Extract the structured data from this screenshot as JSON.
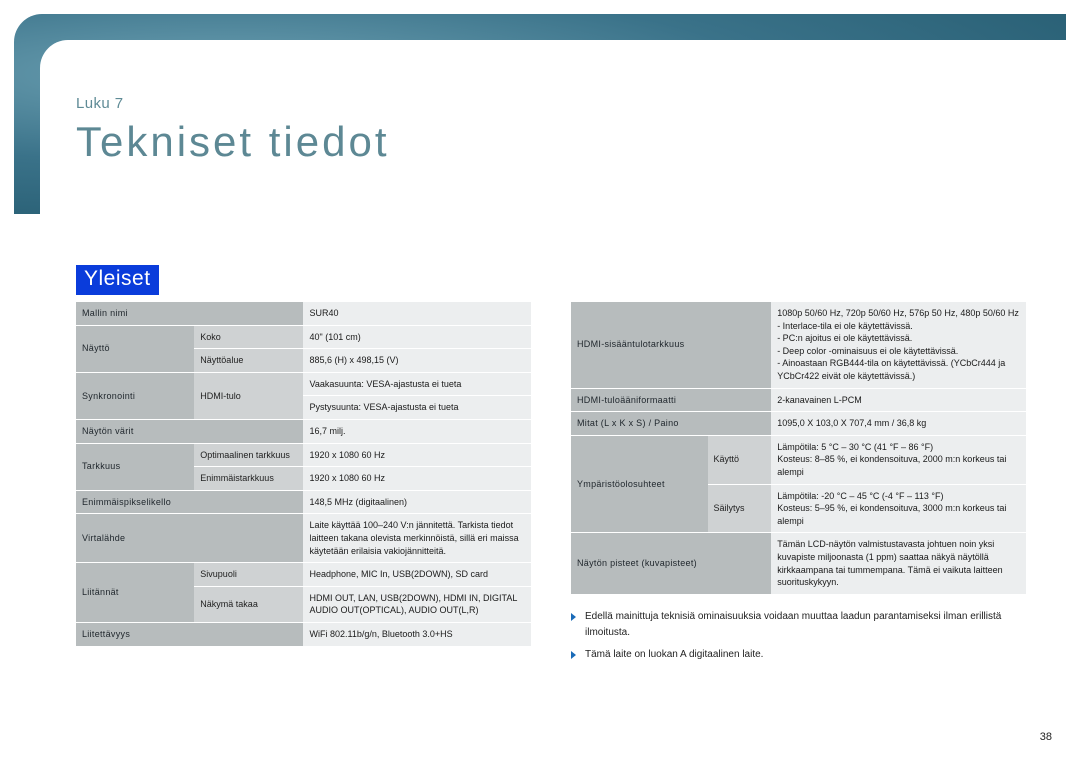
{
  "chapter": "Luku 7",
  "title": "Tekniset tiedot",
  "section": "Yleiset",
  "page_number": "38",
  "left_table": {
    "rows": [
      {
        "cells": [
          {
            "text": "Mallin nimi",
            "class": "hdr",
            "colspan": 2
          },
          {
            "text": "SUR40",
            "class": "val"
          }
        ]
      },
      {
        "cells": [
          {
            "text": "Näyttö",
            "class": "hdr",
            "rowspan": 2
          },
          {
            "text": "Koko",
            "class": "sub"
          },
          {
            "text": "40\" (101 cm)",
            "class": "val"
          }
        ]
      },
      {
        "cells": [
          {
            "text": "Näyttöalue",
            "class": "sub"
          },
          {
            "text": "885,6 (H) x 498,15 (V)",
            "class": "val"
          }
        ]
      },
      {
        "cells": [
          {
            "text": "Synkronointi",
            "class": "hdr",
            "rowspan": 2
          },
          {
            "text": "HDMI-tulo",
            "class": "sub",
            "rowspan": 2
          },
          {
            "text": "Vaakasuunta: VESA-ajastusta ei tueta",
            "class": "val"
          }
        ]
      },
      {
        "cells": [
          {
            "text": "Pystysuunta: VESA-ajastusta ei tueta",
            "class": "val"
          }
        ]
      },
      {
        "cells": [
          {
            "text": "Näytön värit",
            "class": "hdr",
            "colspan": 2
          },
          {
            "text": "16,7 milj.",
            "class": "val"
          }
        ]
      },
      {
        "cells": [
          {
            "text": "Tarkkuus",
            "class": "hdr",
            "rowspan": 2
          },
          {
            "text": "Optimaalinen tarkkuus",
            "class": "sub"
          },
          {
            "text": "1920 x 1080 60 Hz",
            "class": "val"
          }
        ]
      },
      {
        "cells": [
          {
            "text": "Enimmäistarkkuus",
            "class": "sub"
          },
          {
            "text": "1920 x 1080 60 Hz",
            "class": "val"
          }
        ]
      },
      {
        "cells": [
          {
            "text": "Enimmäispikselikello",
            "class": "hdr",
            "colspan": 2
          },
          {
            "text": "148,5 MHz (digitaalinen)",
            "class": "val"
          }
        ]
      },
      {
        "cells": [
          {
            "text": "Virtalähde",
            "class": "hdr",
            "colspan": 2
          },
          {
            "text": "Laite käyttää 100–240 V:n jännitettä. Tarkista tiedot laitteen takana olevista merkinnöistä, sillä eri maissa käytetään erilaisia vakiojännitteitä.",
            "class": "val"
          }
        ]
      },
      {
        "cells": [
          {
            "text": "Liitännät",
            "class": "hdr",
            "rowspan": 2
          },
          {
            "text": "Sivupuoli",
            "class": "sub"
          },
          {
            "text": "Headphone, MIC In, USB(2DOWN), SD card",
            "class": "val"
          }
        ]
      },
      {
        "cells": [
          {
            "text": "Näkymä takaa",
            "class": "sub"
          },
          {
            "text": "HDMI OUT, LAN, USB(2DOWN), HDMI IN, DIGITAL AUDIO OUT(OPTICAL), AUDIO OUT(L,R)",
            "class": "val"
          }
        ]
      },
      {
        "cells": [
          {
            "text": "Liitettävyys",
            "class": "hdr",
            "colspan": 2
          },
          {
            "text": "WiFi 802.11b/g/n, Bluetooth 3.0+HS",
            "class": "val"
          }
        ]
      }
    ]
  },
  "right_table": {
    "rows": [
      {
        "cells": [
          {
            "text": "HDMI-sisääntulotarkkuus",
            "class": "hdr",
            "colspan": 2
          },
          {
            "text": "1080p 50/60 Hz, 720p 50/60 Hz, 576p 50 Hz, 480p 50/60 Hz\n- Interlace-tila ei ole käytettävissä.\n- PC:n ajoitus ei ole käytettävissä.\n- Deep color -ominaisuus ei ole käytettävissä.\n- Ainoastaan RGB444-tila on käytettävissä. (YCbCr444 ja YCbCr422 eivät ole käytettävissä.)",
            "class": "val"
          }
        ]
      },
      {
        "cells": [
          {
            "text": "HDMI-tuloääniformaatti",
            "class": "hdr",
            "colspan": 2
          },
          {
            "text": "2-kanavainen L-PCM",
            "class": "val"
          }
        ]
      },
      {
        "cells": [
          {
            "text": "Mitat (L x K x S) / Paino",
            "class": "hdr",
            "colspan": 2
          },
          {
            "text": "1095,0 X 103,0 X 707,4 mm / 36,8 kg",
            "class": "val"
          }
        ]
      },
      {
        "cells": [
          {
            "text": "Ympäristöolosuhteet",
            "class": "hdr",
            "rowspan": 2
          },
          {
            "text": "Käyttö",
            "class": "sub"
          },
          {
            "text": "Lämpötila: 5 °C – 30 °C (41 °F – 86 °F)\nKosteus: 8–85 %, ei kondensoituva, 2000 m:n korkeus tai alempi",
            "class": "val"
          }
        ]
      },
      {
        "cells": [
          {
            "text": "Säilytys",
            "class": "sub"
          },
          {
            "text": "Lämpötila:  -20 °C – 45 °C (-4 °F – 113 °F)\nKosteus: 5–95 %, ei kondensoituva, 3000 m:n korkeus tai alempi",
            "class": "val"
          }
        ]
      },
      {
        "cells": [
          {
            "text": "Näytön pisteet (kuvapisteet)",
            "class": "hdr",
            "colspan": 2
          },
          {
            "text": "Tämän LCD-näytön valmistustavasta johtuen noin yksi kuvapiste miljoonasta (1 ppm) saattaa näkyä näytöllä kirkkaampana tai tummempana. Tämä ei vaikuta laitteen suorituskykyyn.",
            "class": "val"
          }
        ]
      }
    ]
  },
  "notes": [
    "Edellä mainittuja teknisiä ominaisuuksia voidaan muuttaa laadun parantamiseksi ilman erillistä ilmoitusta.",
    "Tämä laite on luokan A digitaalinen laite."
  ]
}
